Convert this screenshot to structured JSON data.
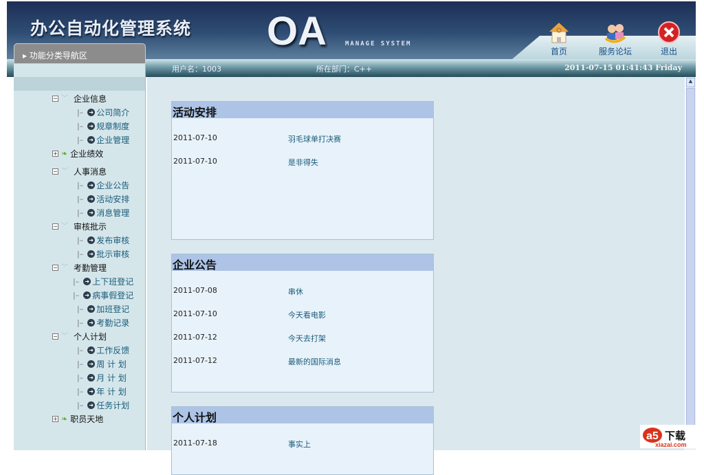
{
  "header": {
    "title": "办公自动化管理系统",
    "logo": "OA",
    "subtitle": "MANAGE SYSTEM",
    "nav": [
      {
        "label": "首页",
        "icon": "home-icon"
      },
      {
        "label": "服务论坛",
        "icon": "forum-icon"
      },
      {
        "label": "退出",
        "icon": "exit-icon"
      }
    ]
  },
  "infobar": {
    "user": "用户名：1003",
    "dept": "所在部门：C++",
    "datetime": "2011-07-15 01:41:43 Friday"
  },
  "sidebar": {
    "title": "功能分类导航区",
    "tree": [
      {
        "label": "企业信息",
        "open": true,
        "children": [
          "公司简介",
          "规章制度",
          "企业管理"
        ]
      },
      {
        "label": "企业绩效",
        "open": false,
        "children": []
      },
      {
        "label": "人事消息",
        "open": true,
        "children": [
          "企业公告",
          "活动安排",
          "消息管理"
        ]
      },
      {
        "label": "审核批示",
        "open": true,
        "children": [
          "发布审核",
          "批示审核"
        ]
      },
      {
        "label": "考勤管理",
        "open": true,
        "children": [
          "上下班登记",
          "病事假登记",
          "加班登记",
          "考勤记录"
        ]
      },
      {
        "label": "个人计划",
        "open": true,
        "children": [
          "工作反馈",
          "周 计 划",
          "月 计 划",
          "年 计 划",
          "任务计划"
        ]
      },
      {
        "label": "职员天地",
        "open": false,
        "children": []
      }
    ]
  },
  "panels": [
    {
      "title": "活动安排",
      "rows": [
        {
          "date": "2011-07-10",
          "name": "羽毛球单打决赛"
        },
        {
          "date": "2011-07-10",
          "name": "是非得失"
        }
      ]
    },
    {
      "title": "企业公告",
      "rows": [
        {
          "date": "2011-07-08",
          "name": "串休"
        },
        {
          "date": "2011-07-10",
          "name": "今天看电影"
        },
        {
          "date": "2011-07-12",
          "name": "今天去打架"
        },
        {
          "date": "2011-07-12",
          "name": "最新的国际消息"
        }
      ]
    },
    {
      "title": "个人计划",
      "rows": [
        {
          "date": "2011-07-18",
          "name": "事实上"
        }
      ]
    }
  ],
  "watermark": {
    "brand": "a5",
    "text": "下载",
    "url": "xiazai.com"
  }
}
